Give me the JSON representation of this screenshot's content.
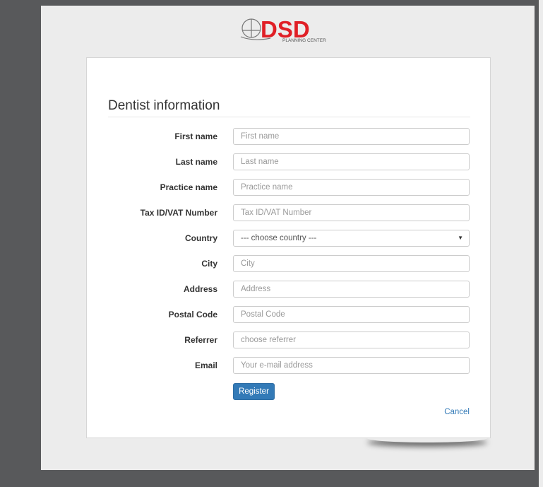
{
  "brand": {
    "logo_text": "DSD",
    "logo_sub": "PLANNING CENTER",
    "accent_color": "#e01f26"
  },
  "form": {
    "heading": "Dentist information",
    "fields": [
      {
        "label": "First name",
        "placeholder": "First name"
      },
      {
        "label": "Last name",
        "placeholder": "Last name"
      },
      {
        "label": "Practice name",
        "placeholder": "Practice name"
      },
      {
        "label": "Tax ID/VAT Number",
        "placeholder": "Tax ID/VAT Number"
      },
      {
        "label": "Country",
        "selected": "--- choose country ---"
      },
      {
        "label": "City",
        "placeholder": "City"
      },
      {
        "label": "Address",
        "placeholder": "Address"
      },
      {
        "label": "Postal Code",
        "placeholder": "Postal Code"
      },
      {
        "label": "Referrer",
        "placeholder": "choose referrer"
      },
      {
        "label": "Email",
        "placeholder": "Your e-mail address"
      }
    ],
    "register_label": "Register",
    "cancel_label": "Cancel",
    "button_color": "#337ab7"
  }
}
